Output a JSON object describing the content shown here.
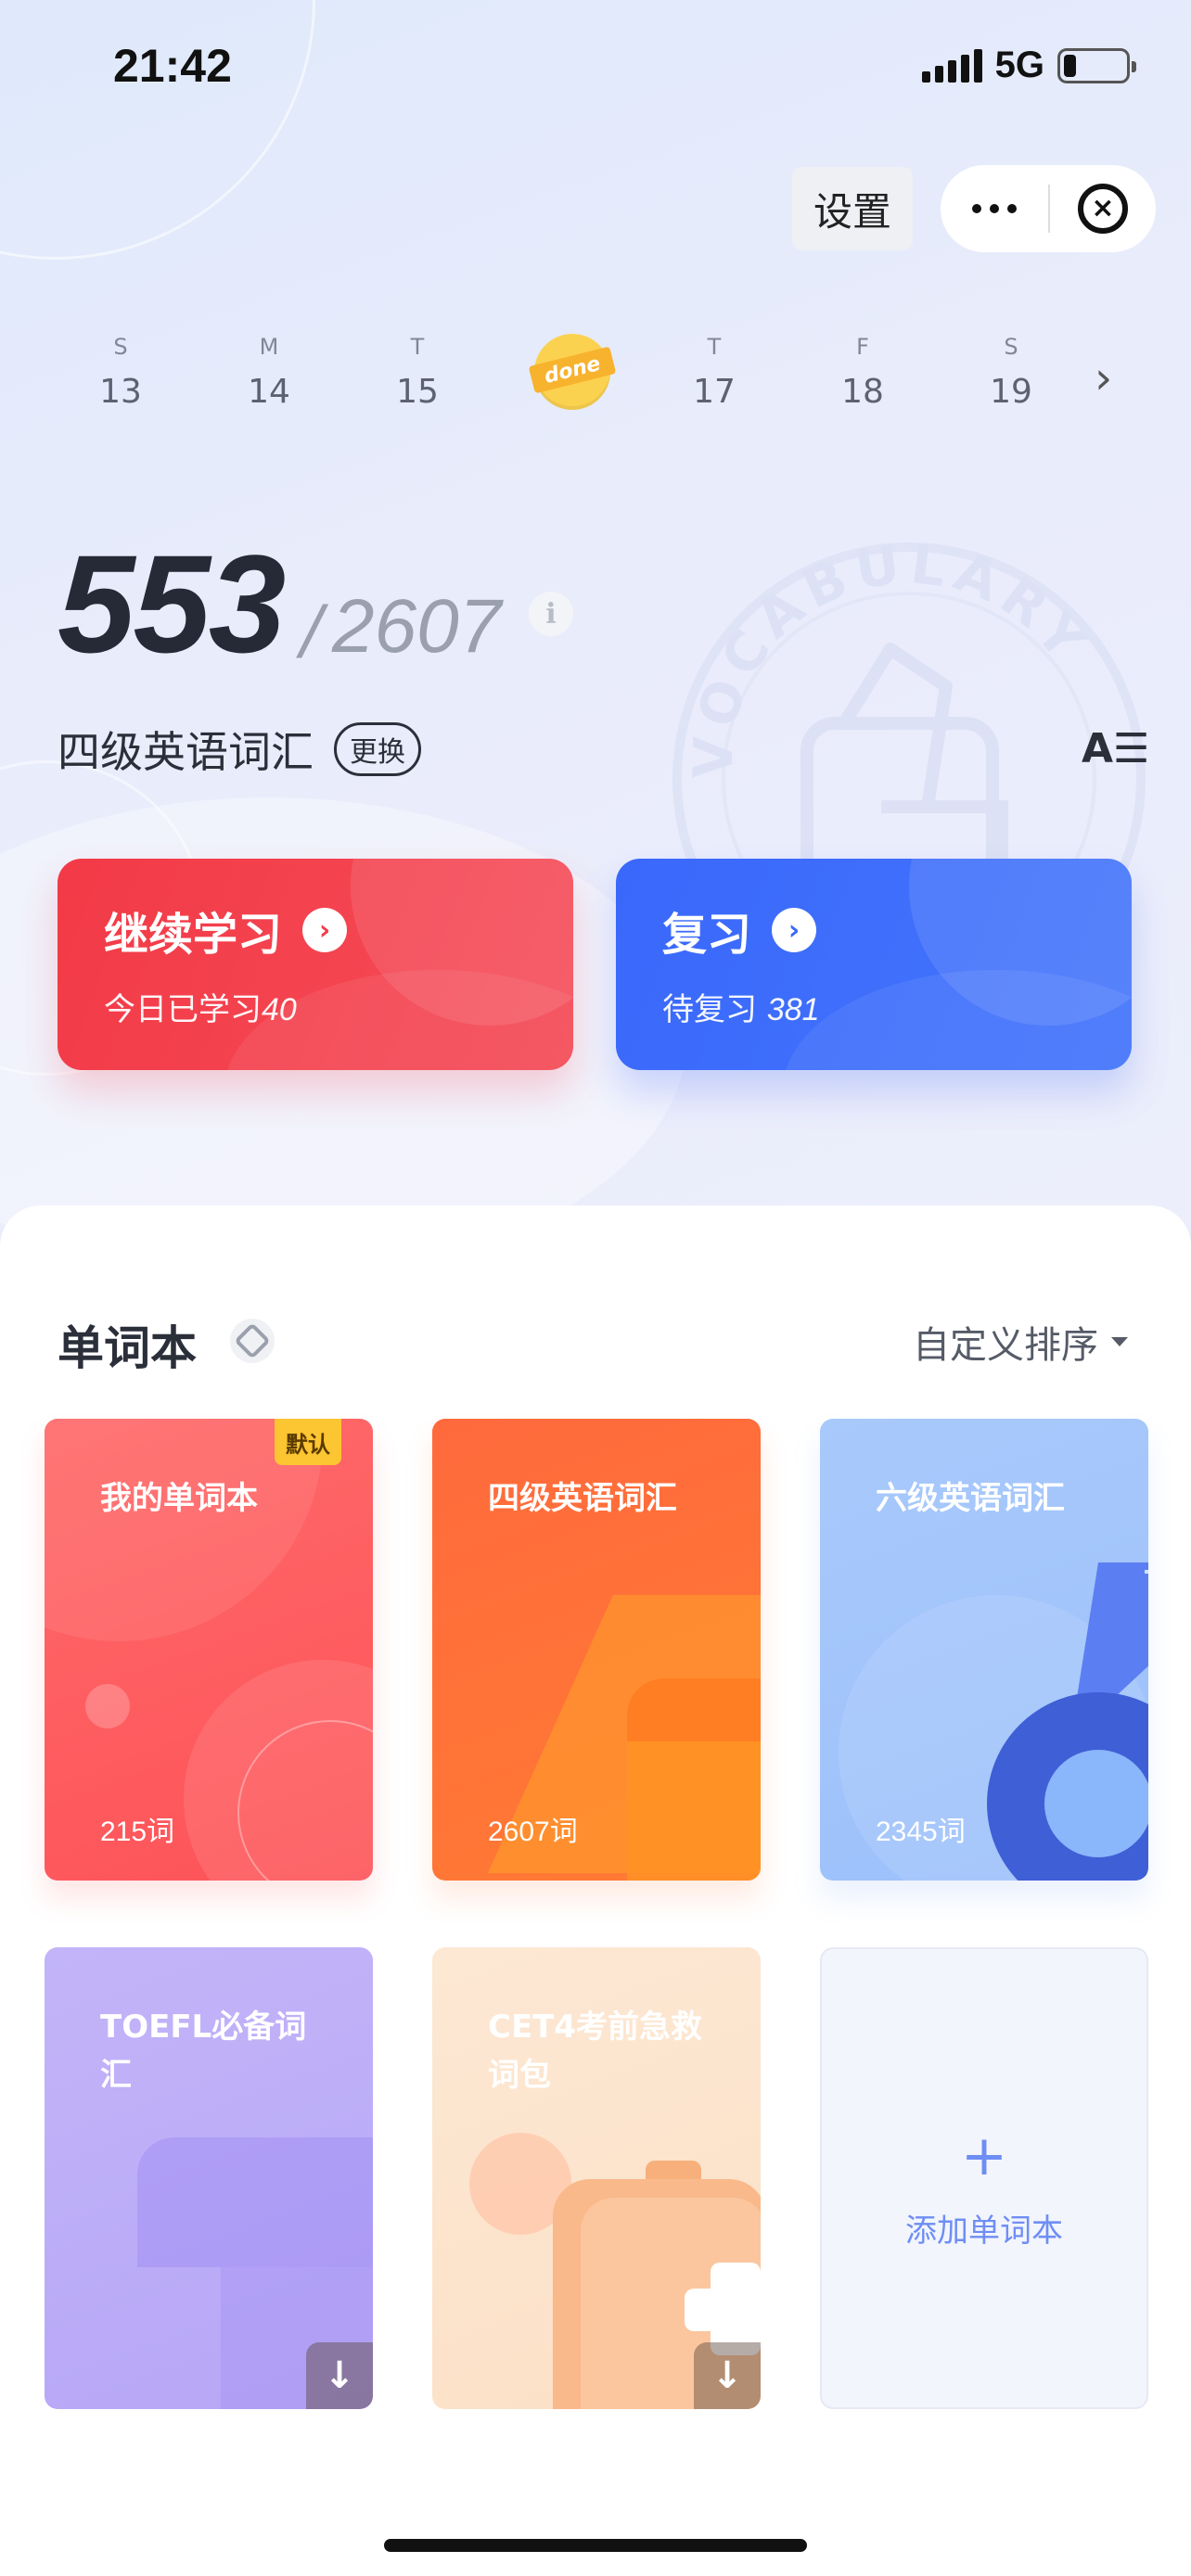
{
  "status_bar": {
    "time": "21:42",
    "network": "5G",
    "battery_level": 0.2
  },
  "top_bar": {
    "settings_label": "设置"
  },
  "week": {
    "days": [
      {
        "dow": "S",
        "date": "13"
      },
      {
        "dow": "M",
        "date": "14"
      },
      {
        "dow": "T",
        "date": "15"
      },
      {
        "dow": "",
        "date": "",
        "badge": "done"
      },
      {
        "dow": "T",
        "date": "17"
      },
      {
        "dow": "F",
        "date": "18"
      },
      {
        "dow": "S",
        "date": "19"
      }
    ],
    "next_icon": "chevron-right-icon"
  },
  "progress": {
    "learned": "553",
    "separator": "/",
    "total": "2607",
    "info_icon": "i"
  },
  "current_book": {
    "title": "四级英语词汇",
    "switch_label": "更换",
    "font_icon": "A☰"
  },
  "actions": {
    "continue": {
      "label": "继续学习",
      "sub_prefix": "今日已学习",
      "sub_value": "40",
      "color": "#f33a47"
    },
    "review": {
      "label": "复习",
      "sub_prefix": "待复习 ",
      "sub_value": "381",
      "color": "#3a68fb"
    }
  },
  "wordbooks": {
    "title": "单词本",
    "sort_label": "自定义排序",
    "items": [
      {
        "title": "我的单词本",
        "count": "215词",
        "tag": "默认"
      },
      {
        "title": "四级英语词汇",
        "count": "2607词"
      },
      {
        "title": "六级英语词汇",
        "count": "2345词"
      },
      {
        "title": "TOEFL必备词汇",
        "count": ""
      },
      {
        "title": "CET4考前急救词包",
        "count": ""
      }
    ],
    "add_label": "添加单词本",
    "add_icon": "+"
  }
}
